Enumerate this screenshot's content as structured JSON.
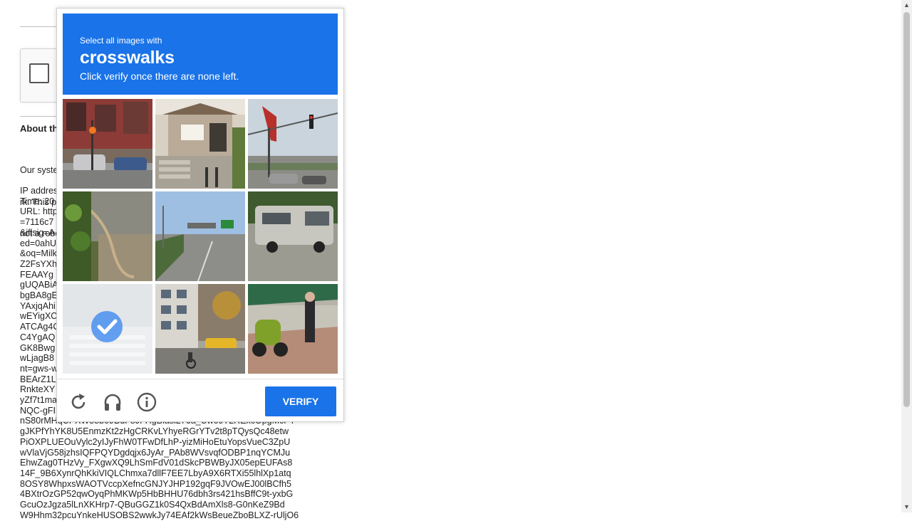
{
  "background": {
    "about_heading": "About th",
    "paragraph_lines": [
      "Our syste",
      "rk. This p",
      "not a robo"
    ],
    "info_lines": [
      "IP addres",
      "Time: 20",
      "URL: http",
      "=7116c7",
      "&iflsig=A",
      "ed=0ahU",
      "&oq=Milk",
      "Z2FsYXh",
      "FEAAYg",
      "gUQABiA",
      "bgBA8gE",
      "YAxjqAhi",
      "wEYigXC",
      "ATCAg4C",
      "C4YgAQ",
      "GK8Bwg",
      "wLjagB8",
      "nt=gws-w",
      "BEArZ1L",
      "RnkteXY",
      "yZf7t1ma",
      "NQC-gFI",
      "nS80rMHqCPXW58b09BuF8JFHgBlasl276a_Uw09T2RExcOpgMcPT",
      "gJKPfYhYK8U5EnmzKt2zHgCRKvLYhyeRGrYTv2t8pTQysQc48etw",
      "PiOXPLUEOuVylc2yIJyFhW0TFwDfLhP-yizMiHoEtuYopsVueC3ZpU",
      "wVlaVjG58jzhsIQFPQYDgdqjx6JyAr_PAb8WVsvqfODBP1nqYCMJu",
      "EhwZag0THzVy_FXgwXQ9LhSmFdV01dSkcPBWByJX05epEUFAs8",
      "14F_9B6XynrQhKkiVIQLChmxa7dllF7EE7LbyA9X6RTXi55lhlXp1atq",
      "8OSY8WhpxsWAOTVccpXefncGNJYJHP192gqF9JVOwEJ00lBCfh5",
      "4BXtrOzGP52qwOyqPhMKWp5HbBHHU76dbh3rs421hsBffC9t-yxbG",
      "GcuOzJgza5lLnXKHrp7-QBuGGZ1k0S4QxBdAmXls8-G0nKeZ9Bd",
      "W9Hhm32pcuYnkeHUSOBS2wwkJy74EAf2kWsBeueZboBLXZ-rUljO6"
    ]
  },
  "challenge": {
    "instruction_small": "Select all images with",
    "target": "crosswalks",
    "instruction_sub": "Click verify once there are none left.",
    "tiles": [
      {
        "label": "tile-1",
        "selected": false
      },
      {
        "label": "tile-2",
        "selected": false
      },
      {
        "label": "tile-3",
        "selected": false
      },
      {
        "label": "tile-4",
        "selected": false
      },
      {
        "label": "tile-5",
        "selected": false
      },
      {
        "label": "tile-6",
        "selected": false
      },
      {
        "label": "tile-7",
        "selected": true
      },
      {
        "label": "tile-8",
        "selected": false
      },
      {
        "label": "tile-9",
        "selected": false
      }
    ],
    "verify_label": "VERIFY",
    "icons": [
      "reload-icon",
      "audio-icon",
      "info-icon"
    ],
    "accent_color": "#1a73e8"
  }
}
